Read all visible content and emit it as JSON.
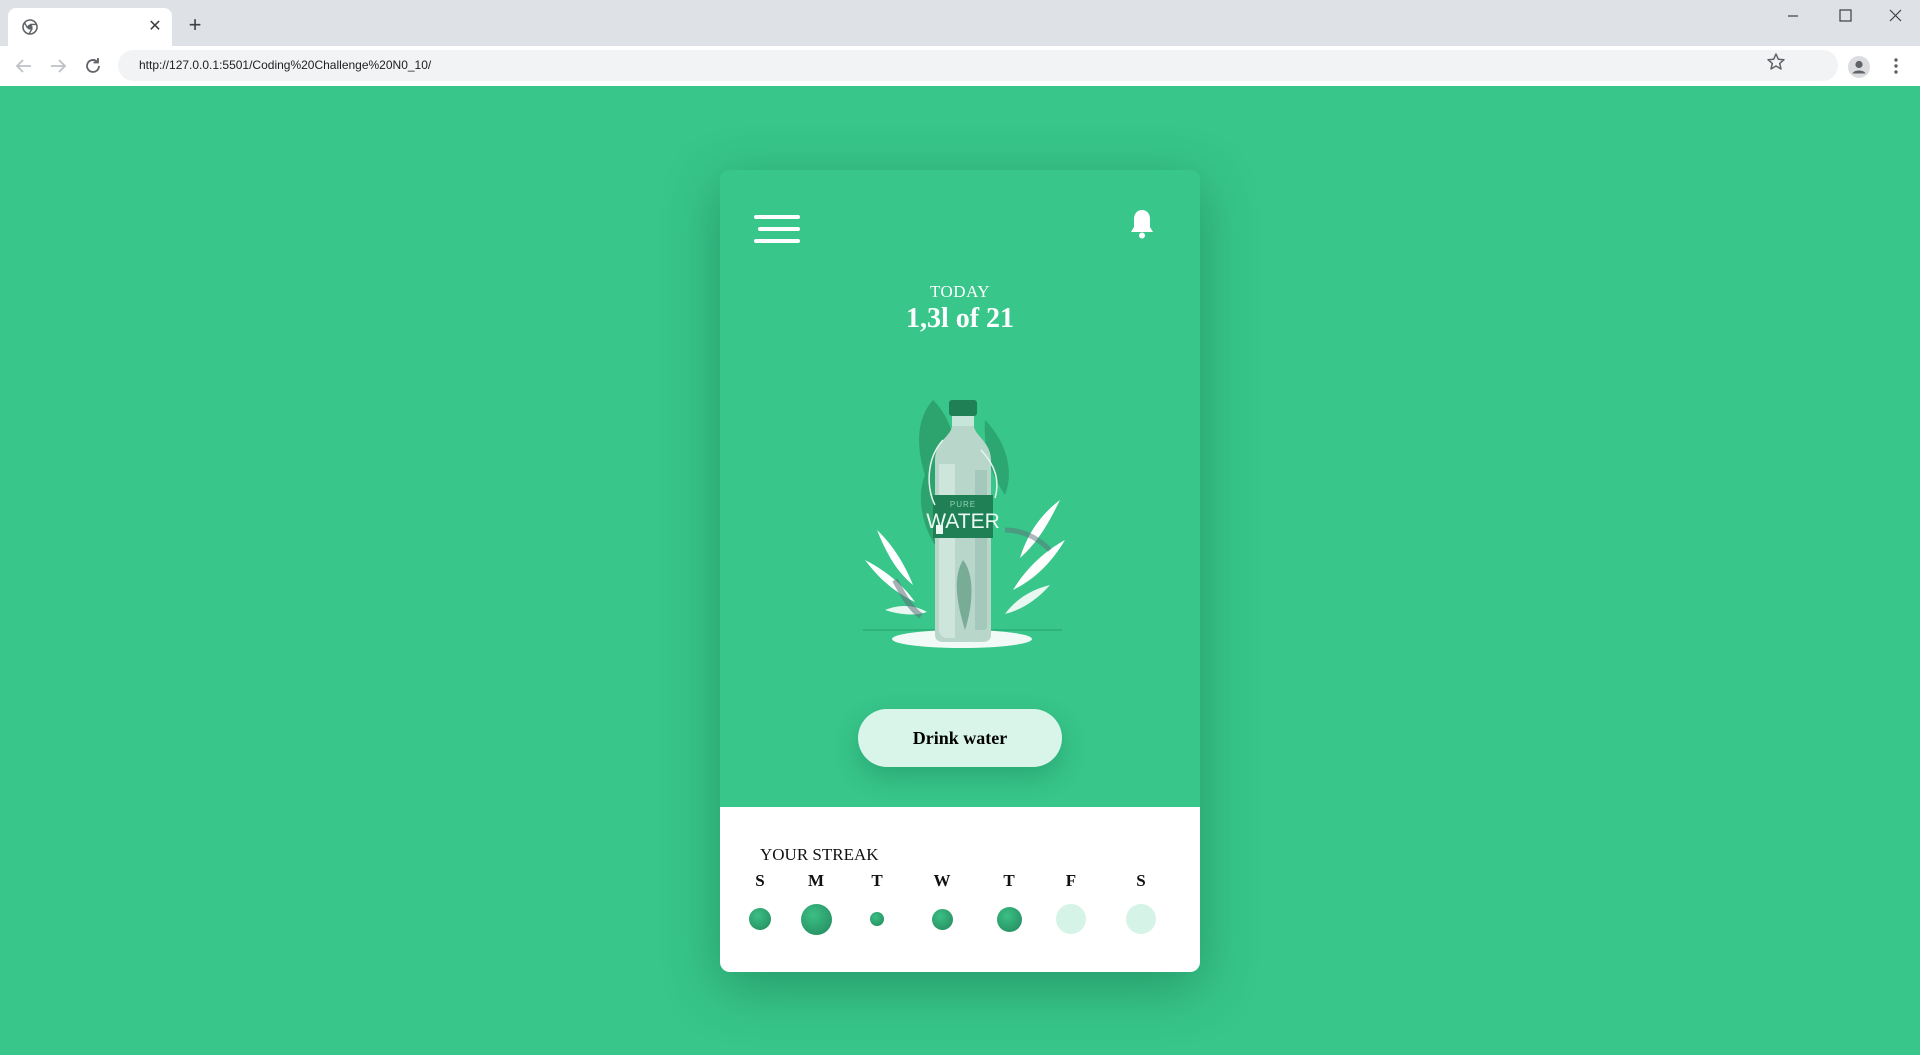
{
  "browser": {
    "tab_close": "✕",
    "new_tab": "+",
    "url": "http://127.0.0.1:5501/Coding%20Challenge%20N0_10/",
    "icons": [
      "chrome-icon",
      "back-icon",
      "forward-icon",
      "reload-icon",
      "star-icon",
      "profile-icon",
      "kebab-menu-icon",
      "minimize-icon",
      "maximize-icon",
      "close-icon"
    ]
  },
  "app": {
    "today_label": "TODAY",
    "today_amount": "1,3l of 21",
    "bottle_label_top": "PURE",
    "bottle_label_main": "WATER",
    "drink_button": "Drink water",
    "streak_title": "YOUR STREAK",
    "days": [
      {
        "label": "S",
        "state": "full",
        "level": 0.6
      },
      {
        "label": "M",
        "state": "full",
        "level": 0.95
      },
      {
        "label": "T",
        "state": "full",
        "level": 0.25
      },
      {
        "label": "W",
        "state": "full",
        "level": 0.55
      },
      {
        "label": "T",
        "state": "full",
        "level": 0.7
      },
      {
        "label": "F",
        "state": "empty",
        "level": 0
      },
      {
        "label": "S",
        "state": "empty",
        "level": 0
      }
    ],
    "colors": {
      "background": "#38c68a",
      "accent_dark": "#22875b",
      "button_bg": "#d9f5ea",
      "empty_dot": "#d6f3e7"
    }
  }
}
